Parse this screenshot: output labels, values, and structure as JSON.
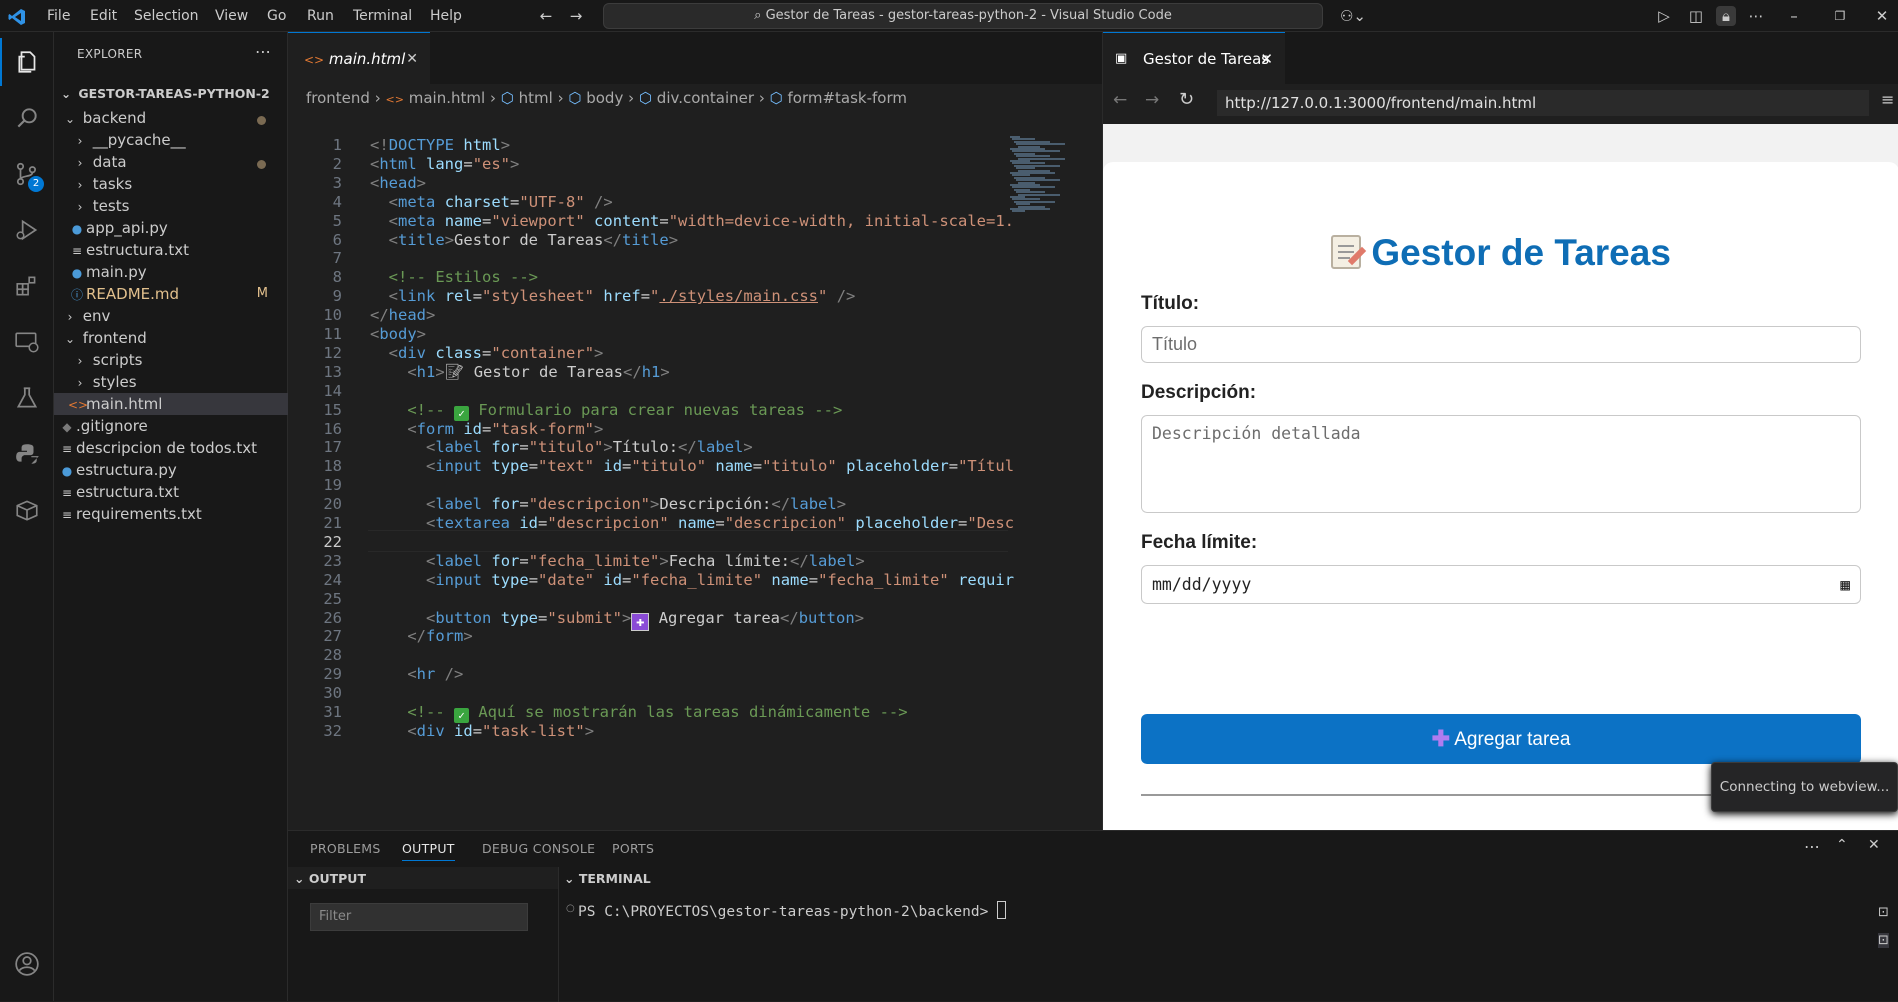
{
  "window": {
    "title": "Gestor de Tareas - gestor-tareas-python-2 - Visual Studio Code",
    "menu": [
      "File",
      "Edit",
      "Selection",
      "View",
      "Go",
      "Run",
      "Terminal",
      "Help"
    ]
  },
  "activity": {
    "scm_badge": "2"
  },
  "explorer": {
    "header": "EXPLORER",
    "root": "GESTOR-TAREAS-PYTHON-2",
    "items": [
      {
        "label": "backend",
        "type": "folder-open",
        "depth": 1,
        "modified_dot": true
      },
      {
        "label": "__pycache__",
        "type": "folder",
        "depth": 2
      },
      {
        "label": "data",
        "type": "folder",
        "depth": 2,
        "modified_dot": true
      },
      {
        "label": "tasks",
        "type": "folder",
        "depth": 2
      },
      {
        "label": "tests",
        "type": "folder",
        "depth": 2
      },
      {
        "label": "app_api.py",
        "type": "python",
        "depth": 2
      },
      {
        "label": "estructura.txt",
        "type": "text",
        "depth": 2
      },
      {
        "label": "main.py",
        "type": "python",
        "depth": 2
      },
      {
        "label": "README.md",
        "type": "info",
        "depth": 2,
        "flag": "M"
      },
      {
        "label": "env",
        "type": "folder",
        "depth": 1
      },
      {
        "label": "frontend",
        "type": "folder-open",
        "depth": 1
      },
      {
        "label": "scripts",
        "type": "folder",
        "depth": 2
      },
      {
        "label": "styles",
        "type": "folder",
        "depth": 2
      },
      {
        "label": "main.html",
        "type": "html",
        "depth": 2,
        "selected": true
      },
      {
        "label": ".gitignore",
        "type": "git",
        "depth": 1
      },
      {
        "label": "descripcion de todos.txt",
        "type": "text",
        "depth": 1
      },
      {
        "label": "estructura.py",
        "type": "python",
        "depth": 1
      },
      {
        "label": "estructura.txt",
        "type": "text",
        "depth": 1
      },
      {
        "label": "requirements.txt",
        "type": "text",
        "depth": 1
      }
    ]
  },
  "editor": {
    "tab": "main.html",
    "breadcrumbs": [
      "frontend",
      "main.html",
      "html",
      "body",
      "div.container",
      "form#task-form"
    ],
    "current_line": 22
  },
  "preview": {
    "tab": "Gestor de Tareas",
    "url": "http://127.0.0.1:3000/frontend/main.html",
    "app": {
      "title": "Gestor de Tareas",
      "titulo_label": "Título:",
      "titulo_placeholder": "Título",
      "descripcion_label": "Descripción:",
      "descripcion_placeholder": "Descripción detallada",
      "fecha_label": "Fecha límite:",
      "fecha_placeholder": "mm/dd/yyyy",
      "submit": "Agregar tarea"
    },
    "toast": "Connecting to webview..."
  },
  "panel": {
    "tabs": [
      "PROBLEMS",
      "OUTPUT",
      "DEBUG CONSOLE",
      "PORTS"
    ],
    "active_tab": "OUTPUT",
    "output_header": "OUTPUT",
    "terminal_header": "TERMINAL",
    "filter_placeholder": "Filter",
    "prompt": "PS C:\\PROYECTOS\\gestor-tareas-python-2\\backend> "
  },
  "colors": {
    "accent": "#0078d4",
    "app_title": "#0e6db5",
    "button": "#0c72c5"
  }
}
